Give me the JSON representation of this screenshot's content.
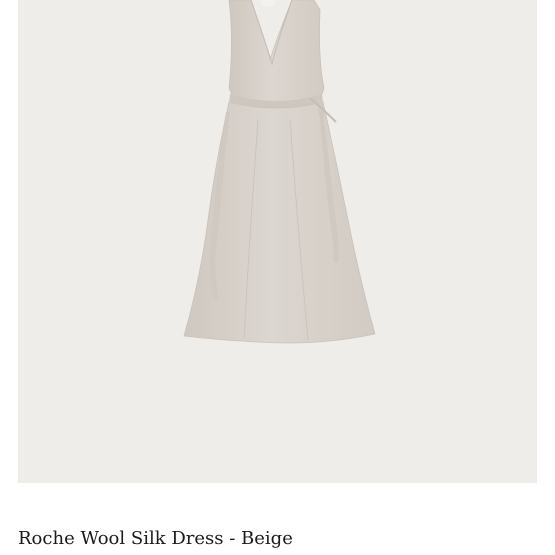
{
  "product": {
    "title": "Roche Wool Silk Dress - Beige",
    "image_background": "#efede9",
    "dress_color": "#d9d3cd"
  }
}
